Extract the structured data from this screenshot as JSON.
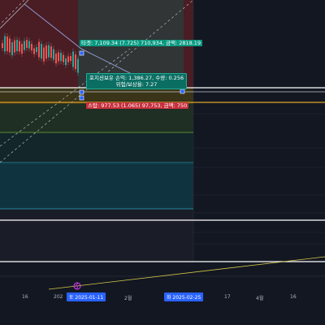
{
  "labels": {
    "target": "타겟: 7,109.34 (7.725) 710,934, 금액: 2818.19",
    "position_line1": "포지션보유 손익: 1,386.27, 수량: 0.256",
    "position_line2": "위험/보상율: 7.27",
    "stop": "스탑: 977.53 (1.065) 97,753, 금액: 750"
  },
  "xaxis": {
    "tick_16a": "16",
    "tick_2025": "202",
    "start_badge": "토 2025-01-11",
    "tick_feb": "2월",
    "end_badge": "화 2025-02-25",
    "tick_17": "17",
    "tick_apr": "4월",
    "tick_16b": "16"
  },
  "colors": {
    "target_zone": "#089981",
    "stop_zone": "#f23645",
    "bull": "#26a69a",
    "bear": "#ef5350",
    "badge": "#2962ff"
  }
}
